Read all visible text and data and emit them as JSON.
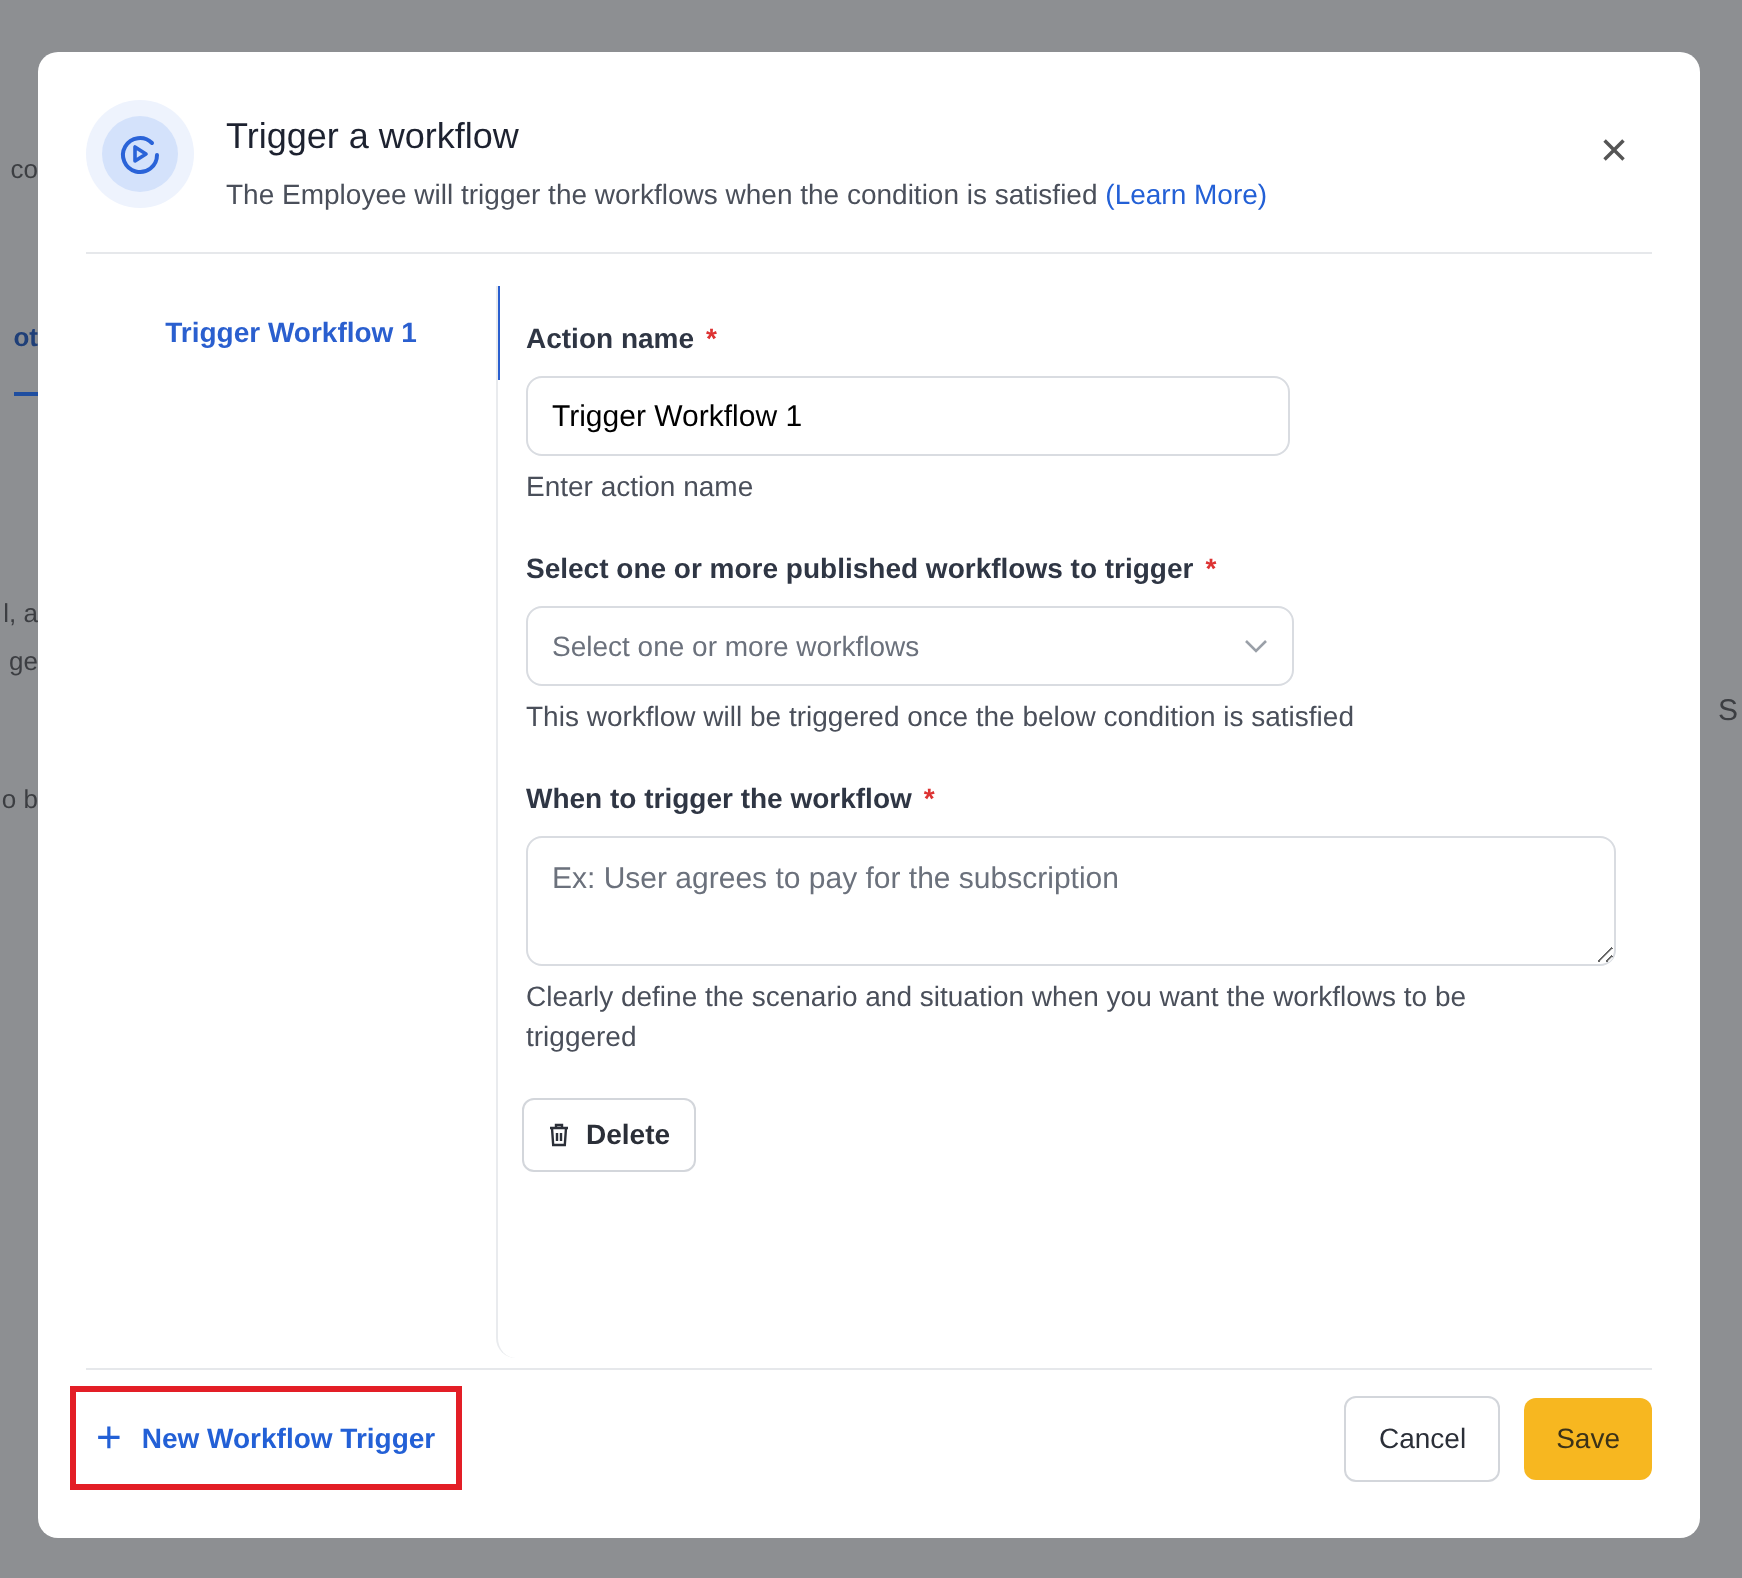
{
  "background_fragments": [
    {
      "text": "co"
    },
    {
      "text": "ot",
      "selected": true
    },
    {
      "text": "l, a"
    },
    {
      "text": "ge"
    },
    {
      "text": "o b"
    }
  ],
  "background_right": [
    {
      "text": "S"
    }
  ],
  "dialog": {
    "title": "Trigger a workflow",
    "subtitle": "The Employee will trigger the workflows when the condition is satisfied",
    "learn_more": "(Learn More)",
    "close": "×"
  },
  "sidebar": {
    "items": [
      {
        "label": "Trigger Workflow 1",
        "selected": true
      }
    ]
  },
  "form": {
    "fields": [
      {
        "kind": "text",
        "label": "Action name",
        "required_mark": "*",
        "value": "Trigger Workflow 1",
        "help": "Enter action name"
      },
      {
        "kind": "select",
        "label": "Select one or more published workflows to trigger",
        "required_mark": "*",
        "placeholder": "Select one or more workflows",
        "help": "This workflow will be triggered once the below condition is satisfied"
      },
      {
        "kind": "textarea",
        "label": "When to trigger the workflow",
        "required_mark": "*",
        "placeholder": "Ex: User agrees to pay for the subscription",
        "help": "Clearly define the scenario and situation when you want the workflows to be triggered"
      }
    ],
    "delete_button": "Delete"
  },
  "footer": {
    "new_trigger": {
      "label": "New Workflow Trigger",
      "icon": "+",
      "highlighted": true
    },
    "cancel": "Cancel",
    "save": "Save"
  }
}
